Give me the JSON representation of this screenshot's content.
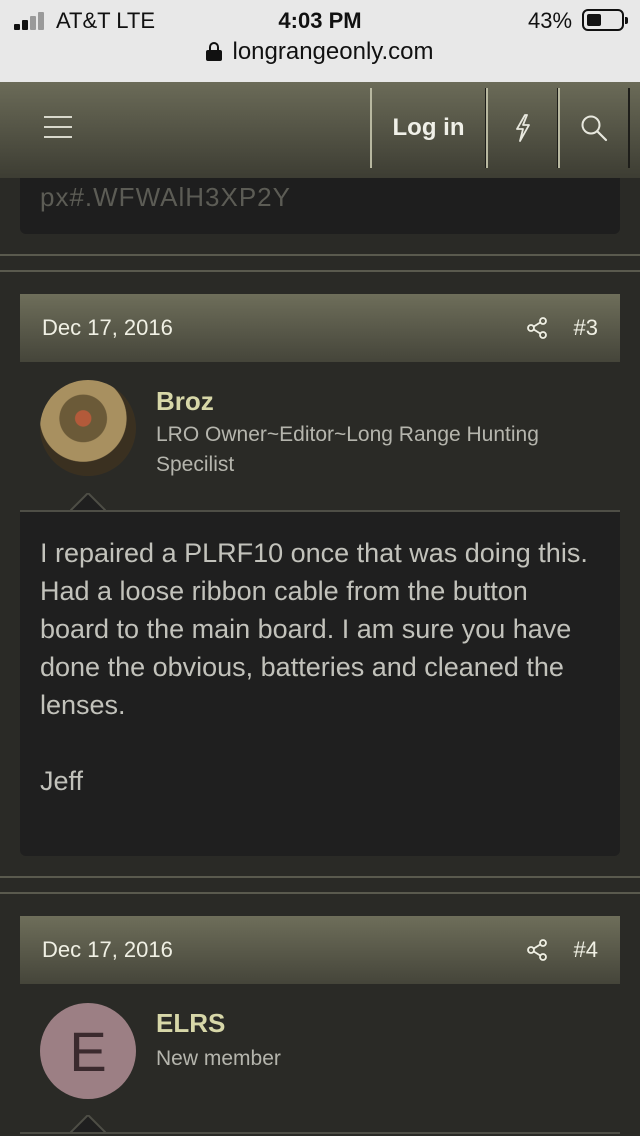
{
  "status_bar": {
    "carrier": "AT&T  LTE",
    "time": "4:03 PM",
    "battery": "43%"
  },
  "address_bar": {
    "url": "longrangeonly.com"
  },
  "header": {
    "login_label": "Log in"
  },
  "code_snippet": "px#.WFWAlH3XP2Y",
  "posts": [
    {
      "date": "Dec 17, 2016",
      "number": "#3",
      "username": "Broz",
      "user_title": "LRO Owner~Editor~Long Range Hunting Specilist",
      "body": "I repaired a PLRF10 once that was doing this. Had a loose ribbon cable from the button board to the main board. I am sure you have done the obvious, batteries and cleaned the lenses.",
      "signature": "Jeff"
    },
    {
      "date": "Dec 17, 2016",
      "number": "#4",
      "avatar_letter": "E",
      "username": "ELRS",
      "user_title": "New member"
    }
  ]
}
